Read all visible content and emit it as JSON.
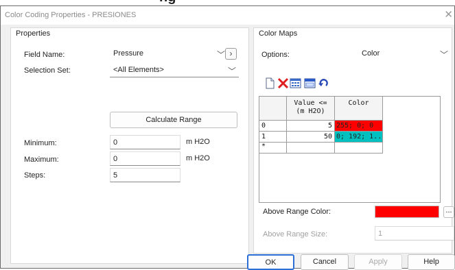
{
  "background_caption": "ng",
  "window": {
    "title": "Color Coding Properties - PRESIONES"
  },
  "properties": {
    "group_label": "Properties",
    "field_name": {
      "label": "Field Name:",
      "value": "Pressure"
    },
    "selection_set": {
      "label": "Selection Set:",
      "value": "<All Elements>"
    },
    "calculate_range_label": "Calculate Range",
    "minimum": {
      "label": "Minimum:",
      "value": "0",
      "unit": "m H2O"
    },
    "maximum": {
      "label": "Maximum:",
      "value": "0",
      "unit": "m H2O"
    },
    "steps": {
      "label": "Steps:",
      "value": "5"
    }
  },
  "color_maps": {
    "group_label": "Color Maps",
    "options": {
      "label": "Options:",
      "value": "Color"
    },
    "toolbar_icons": [
      "new-icon",
      "delete-icon",
      "ramp-icon",
      "calendar-icon",
      "initialize-icon"
    ],
    "table": {
      "col_value_line1": "Value <=",
      "col_value_line2": "(m H2O)",
      "col_color": "Color",
      "rows": [
        {
          "index": "0",
          "value": "5",
          "color_text": "255; 0; 0",
          "color_hex": "#ff0000"
        },
        {
          "index": "1",
          "value": "50",
          "color_text": "0; 192; 1...",
          "color_hex": "#00c0c0"
        }
      ],
      "new_row_marker": "*"
    },
    "above_range_color": {
      "label": "Above Range Color:",
      "color_hex": "#ff0000",
      "button_label": "..."
    },
    "above_range_size": {
      "label": "Above Range Size:",
      "value": "1"
    }
  },
  "footer": {
    "ok": "OK",
    "cancel": "Cancel",
    "apply": "Apply",
    "help": "Help"
  }
}
